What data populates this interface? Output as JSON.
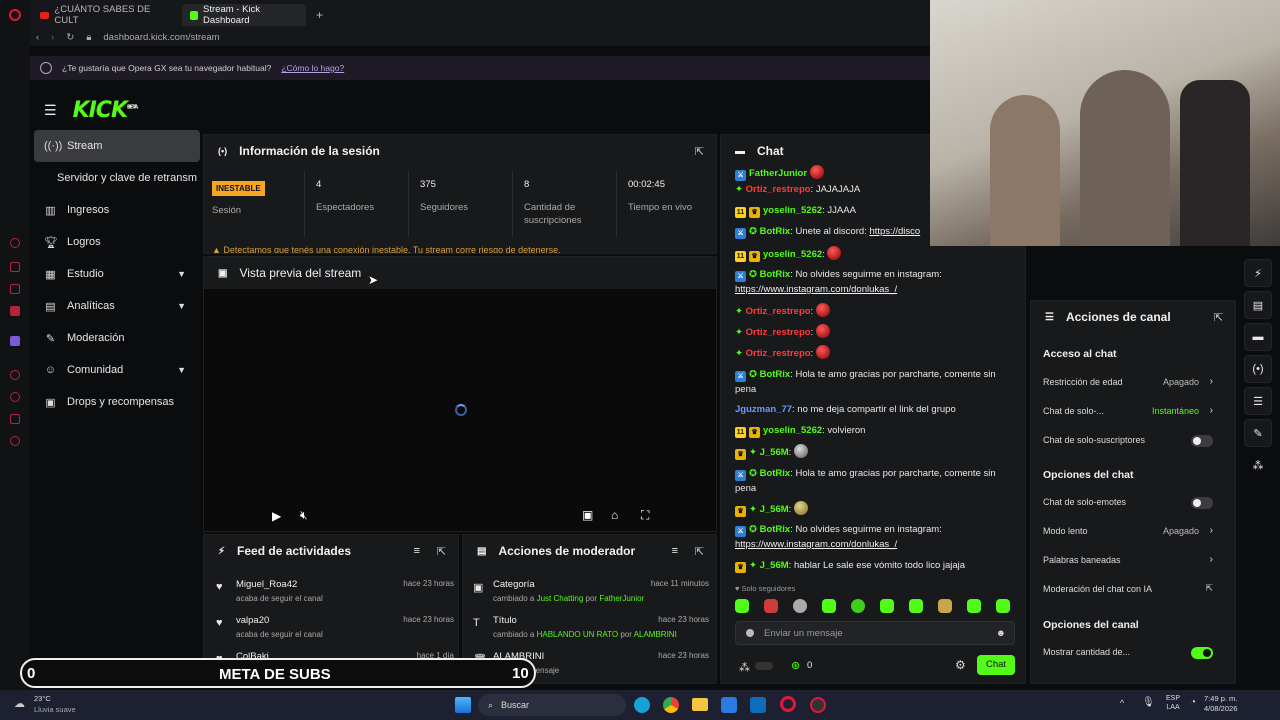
{
  "browser": {
    "tabs": [
      {
        "label": "¿CUÁNTO SABES DE CULT",
        "active": false
      },
      {
        "label": "Stream - Kick Dashboard",
        "active": true
      }
    ],
    "new_tab": "+",
    "url": "dashboard.kick.com/stream",
    "infobar_text": "¿Te gustaría que Opera GX sea tu navegador habitual?",
    "infobar_link": "¿Cómo lo hago?"
  },
  "brand": {
    "logo": "KICK",
    "logo_sup": "BETA",
    "accent": "#53fc18"
  },
  "sidebar": {
    "items": [
      {
        "label": "Stream",
        "icon": "broadcast-icon",
        "active": true
      },
      {
        "label": "Servidor y clave de retransm",
        "icon": "",
        "active": false
      },
      {
        "label": "Ingresos",
        "icon": "chart-icon"
      },
      {
        "label": "Logros",
        "icon": "trophy-icon"
      },
      {
        "label": "Estudio",
        "icon": "grid-icon",
        "expand": true
      },
      {
        "label": "Analíticas",
        "icon": "analytics-icon",
        "expand": true
      },
      {
        "label": "Moderación",
        "icon": "wrench-icon"
      },
      {
        "label": "Comunidad",
        "icon": "community-icon",
        "expand": true
      },
      {
        "label": "Drops y recompensas",
        "icon": "gift-icon"
      }
    ]
  },
  "session": {
    "title": "Información de la sesión",
    "status_badge": "INESTABLE",
    "status_label": "Sesión",
    "stats": [
      {
        "value": "4",
        "label": "Espectadores"
      },
      {
        "value": "375",
        "label": "Seguidores"
      },
      {
        "value": "8",
        "label": "Cantidad de suscripciones"
      },
      {
        "value": "00:02:45",
        "label": "Tiempo en vivo"
      }
    ],
    "warning": "Detectamos que tenés una conexión inestable. Tu stream corre riesgo de detenerse."
  },
  "preview": {
    "title": "Vista previa del stream"
  },
  "activity": {
    "title": "Feed de actividades",
    "items": [
      {
        "name": "Miguel_Roa42",
        "sub": "acaba de seguir el canal",
        "time": "hace 23 horas"
      },
      {
        "name": "valpa20",
        "sub": "acaba de seguir el canal",
        "time": "hace 23 horas"
      },
      {
        "name": "ColBaki",
        "sub": "",
        "time": "hace 1 día"
      }
    ]
  },
  "modactions": {
    "title": "Acciones de moderador",
    "items": [
      {
        "name": "Categoría",
        "sub_pre": "cambiado a ",
        "sub_hl": "Just Chatting",
        "sub_mid": " por ",
        "sub_user": "FatherJunior",
        "time": "hace 11 minutos"
      },
      {
        "name": "Título",
        "sub_pre": "cambiado a ",
        "sub_hl": "HABLANDO UN RATO",
        "sub_mid": " por ",
        "sub_user": "ALAMBRINI",
        "time": "hace 23 horas"
      },
      {
        "name": "ALAMBRINI",
        "sub_pre": "eliminó el mensaje",
        "sub_hl": "",
        "sub_mid": "",
        "sub_user": "",
        "time": "hace 23 horas"
      }
    ]
  },
  "chat": {
    "title": "Chat",
    "messages": [
      {
        "user": "FatherJunior",
        "text": ""
      },
      {
        "user": "Ortiz_restrepo",
        "text": ": JAJAJAJA"
      },
      {
        "user": "yoselin_5262",
        "text": ": JJAAA"
      },
      {
        "user": "BotRix",
        "text": ": Unete al discord: ",
        "link": "https://disco"
      },
      {
        "user": "yoselin_5262",
        "text": ":"
      },
      {
        "user": "BotRix",
        "text": ": No olvides seguirme en instagram:",
        "link": "https://www.instagram.com/donlukas_/"
      },
      {
        "user": "Ortiz_restrepo",
        "text": ":"
      },
      {
        "user": "Ortiz_restrepo",
        "text": ":"
      },
      {
        "user": "Ortiz_restrepo",
        "text": ":"
      },
      {
        "user": "BotRix",
        "text": ": Hola te amo gracias por parcharte, comente sin pena"
      },
      {
        "user": "Jguzman_77",
        "text": ": no me deja compartir el link del grupo"
      },
      {
        "user": "yoselin_5262",
        "text": ": volvieron"
      },
      {
        "user": "J_56M",
        "text": ":"
      },
      {
        "user": "BotRix",
        "text": ": Hola te amo gracias por parcharte, comente sin pena"
      },
      {
        "user": "J_56M",
        "text": ":"
      },
      {
        "user": "BotRix",
        "text": ": No olvides seguirme en instagram:",
        "link": "https://www.instagram.com/donlukas_/"
      },
      {
        "user": "J_56M",
        "text": ": hablar Le sale ese vómito todo lico jajaja"
      }
    ],
    "followers_only": "Solo seguidores",
    "input_placeholder": "Enviar un mensaje",
    "points": "0",
    "send": "Chat"
  },
  "channel_actions": {
    "title": "Acciones de canal",
    "sections": [
      {
        "title": "Acceso al chat",
        "rows": [
          {
            "label": "Restricción de edad",
            "value": "Apagado",
            "type": "arrow"
          },
          {
            "label": "Chat de solo-...",
            "value": "Instantáneo",
            "type": "arrow",
            "green": true
          },
          {
            "label": "Chat de solo-suscriptores",
            "value": "",
            "type": "toggle",
            "on": false
          }
        ]
      },
      {
        "title": "Opciones del chat",
        "rows": [
          {
            "label": "Chat de solo-emotes",
            "value": "",
            "type": "toggle",
            "on": false
          },
          {
            "label": "Modo lento",
            "value": "Apagado",
            "type": "arrow"
          },
          {
            "label": "Palabras baneadas",
            "value": "",
            "type": "arrow"
          },
          {
            "label": "Moderación del chat con IA",
            "value": "",
            "type": "ext"
          }
        ]
      },
      {
        "title": "Opciones del canal",
        "rows": [
          {
            "label": "Mostrar cantidad de...",
            "value": "",
            "type": "toggle",
            "on": true
          }
        ]
      }
    ]
  },
  "subs_goal": {
    "title": "META DE SUBS",
    "current": "0",
    "target": "10",
    "progress": 0
  },
  "taskbar": {
    "weather_temp": "23°C",
    "weather_desc": "Lluvia suave",
    "search": "Buscar",
    "lang": "ESP",
    "lang2": "LAA",
    "time": "7:49 p. m.",
    "date": "4/08/2026"
  }
}
